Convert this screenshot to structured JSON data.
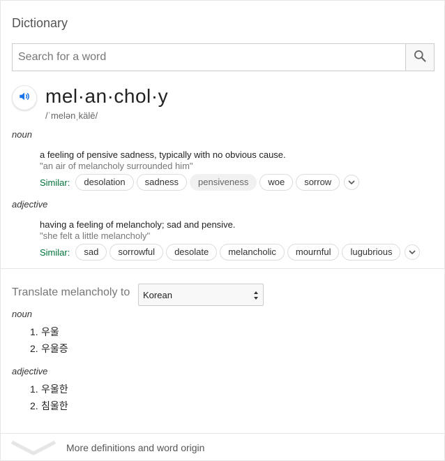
{
  "title": "Dictionary",
  "search": {
    "placeholder": "Search for a word",
    "value": ""
  },
  "entry": {
    "headword": "mel·an·chol·y",
    "phonetic": "/ˈmelənˌkälē/"
  },
  "senses": [
    {
      "pos": "noun",
      "definition": "a feeling of pensive sadness, typically with no obvious cause.",
      "example": "\"an air of melancholy surrounded him\"",
      "similar_label": "Similar:",
      "similar": [
        "desolation",
        "sadness",
        "pensiveness",
        "woe",
        "sorrow"
      ]
    },
    {
      "pos": "adjective",
      "definition": "having a feeling of melancholy; sad and pensive.",
      "example": "\"she felt a little melancholy\"",
      "similar_label": "Similar:",
      "similar": [
        "sad",
        "sorrowful",
        "desolate",
        "melancholic",
        "mournful",
        "lugubrious"
      ]
    }
  ],
  "translate": {
    "label": "Translate melancholy to",
    "selected_language": "Korean",
    "groups": [
      {
        "pos": "noun",
        "items": [
          {
            "num": "1.",
            "text": "우울"
          },
          {
            "num": "2.",
            "text": "우울증"
          }
        ]
      },
      {
        "pos": "adjective",
        "items": [
          {
            "num": "1.",
            "text": "우울한"
          },
          {
            "num": "2.",
            "text": "침울한"
          }
        ]
      }
    ]
  },
  "footer": {
    "more_label": "More definitions and word origin"
  },
  "icons": {
    "search": "search-icon",
    "speaker": "speaker-icon",
    "expand": "chevron-down-icon",
    "select": "select-arrows-icon",
    "more": "chevron-down-icon"
  },
  "colors": {
    "similar_label": "#00733a",
    "speaker_accent": "#1a73e8",
    "muted_text": "#777777"
  }
}
